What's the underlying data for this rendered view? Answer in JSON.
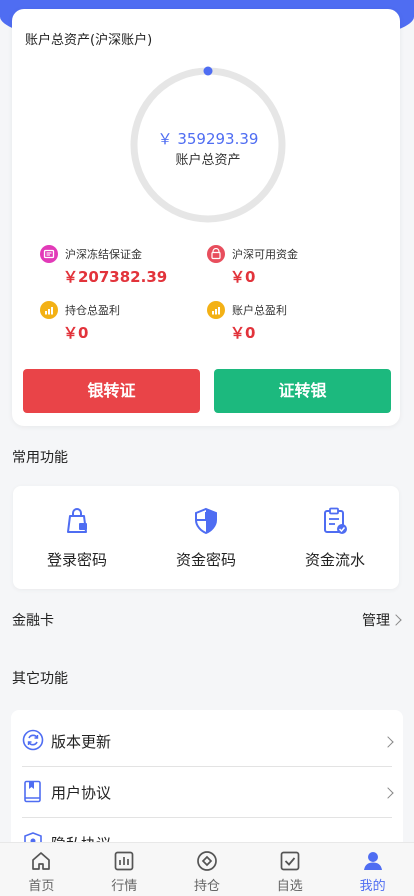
{
  "asset": {
    "title": "账户总资产(沪深账户)",
    "total_amount": "￥ 359293.39",
    "total_label": "账户总资产",
    "ring_progress": 0.0
  },
  "stats": [
    {
      "label": "沪深冻结保证金",
      "value": "￥207382.39",
      "icon": "deposit-icon"
    },
    {
      "label": "沪深可用资金",
      "value": "￥0",
      "icon": "wallet-icon"
    },
    {
      "label": "持仓总盈利",
      "value": "￥0",
      "icon": "profit-chart-icon"
    },
    {
      "label": "账户总盈利",
      "value": "￥0",
      "icon": "profit-chart-icon"
    }
  ],
  "buttons": {
    "bank_to_sec": "银转证",
    "sec_to_bank": "证转银"
  },
  "common": {
    "title": "常用功能",
    "items": [
      {
        "label": "登录密码",
        "icon": "bag-lock-icon"
      },
      {
        "label": "资金密码",
        "icon": "shield-icon"
      },
      {
        "label": "资金流水",
        "icon": "clipboard-check-icon"
      }
    ]
  },
  "bank": {
    "title": "金融卡",
    "manage": "管理"
  },
  "other": {
    "title": "其它功能",
    "items": [
      {
        "label": "版本更新",
        "icon": "refresh-icon"
      },
      {
        "label": "用户协议",
        "icon": "bookmark-doc-icon"
      },
      {
        "label": "隐私协议",
        "icon": "privacy-icon"
      }
    ]
  },
  "tabs": [
    {
      "label": "首页",
      "icon": "home-icon"
    },
    {
      "label": "行情",
      "icon": "chart-icon"
    },
    {
      "label": "持仓",
      "icon": "diamond-icon"
    },
    {
      "label": "自选",
      "icon": "checkbox-icon"
    },
    {
      "label": "我的",
      "icon": "user-icon"
    }
  ],
  "colors": {
    "accent": "#4f6df2",
    "red": "#e94448",
    "green": "#1cb97e",
    "value_red": "#e2333b"
  }
}
